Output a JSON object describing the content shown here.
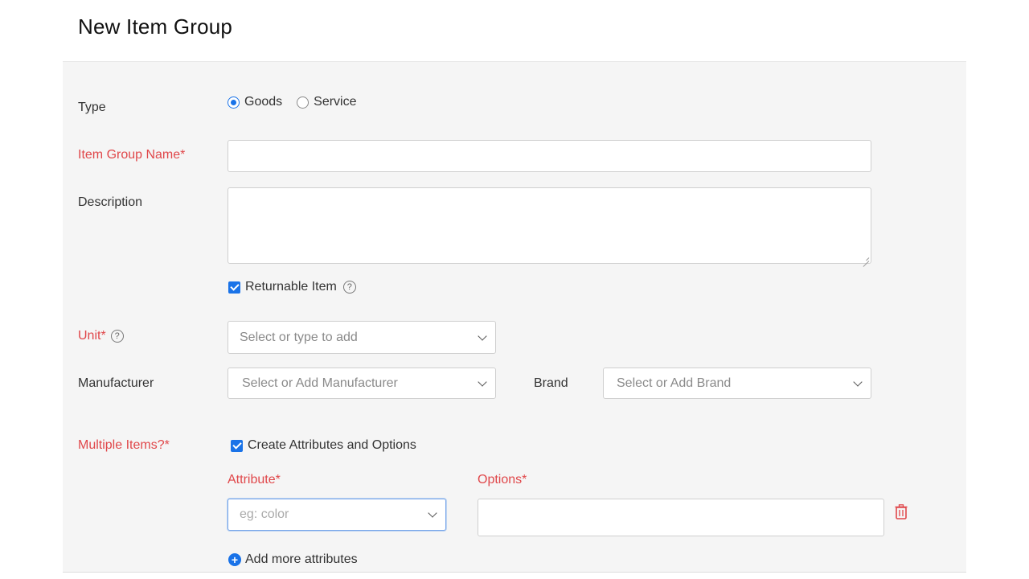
{
  "page": {
    "title": "New Item Group"
  },
  "type": {
    "label": "Type",
    "options": [
      {
        "label": "Goods",
        "selected": true
      },
      {
        "label": "Service",
        "selected": false
      }
    ]
  },
  "item_group_name": {
    "label": "Item Group Name*",
    "value": ""
  },
  "description": {
    "label": "Description",
    "value": ""
  },
  "returnable": {
    "label": "Returnable Item",
    "checked": true,
    "help_icon": "?"
  },
  "unit": {
    "label": "Unit*",
    "help_icon": "?",
    "placeholder": "Select or type to add"
  },
  "manufacturer": {
    "label": "Manufacturer",
    "placeholder": "Select or Add Manufacturer"
  },
  "brand": {
    "label": "Brand",
    "placeholder": "Select or Add Brand"
  },
  "multiple_items": {
    "label": "Multiple Items?*",
    "checkbox_label": "Create Attributes and Options",
    "checked": true
  },
  "attributes": {
    "attribute_label": "Attribute*",
    "attribute_placeholder": "eg: color",
    "options_label": "Options*",
    "options_value": "",
    "add_more_label": "Add more attributes",
    "add_icon": "+"
  },
  "colors": {
    "accent": "#1a73e8",
    "required": "#e0474a",
    "delete": "#e0474a"
  }
}
